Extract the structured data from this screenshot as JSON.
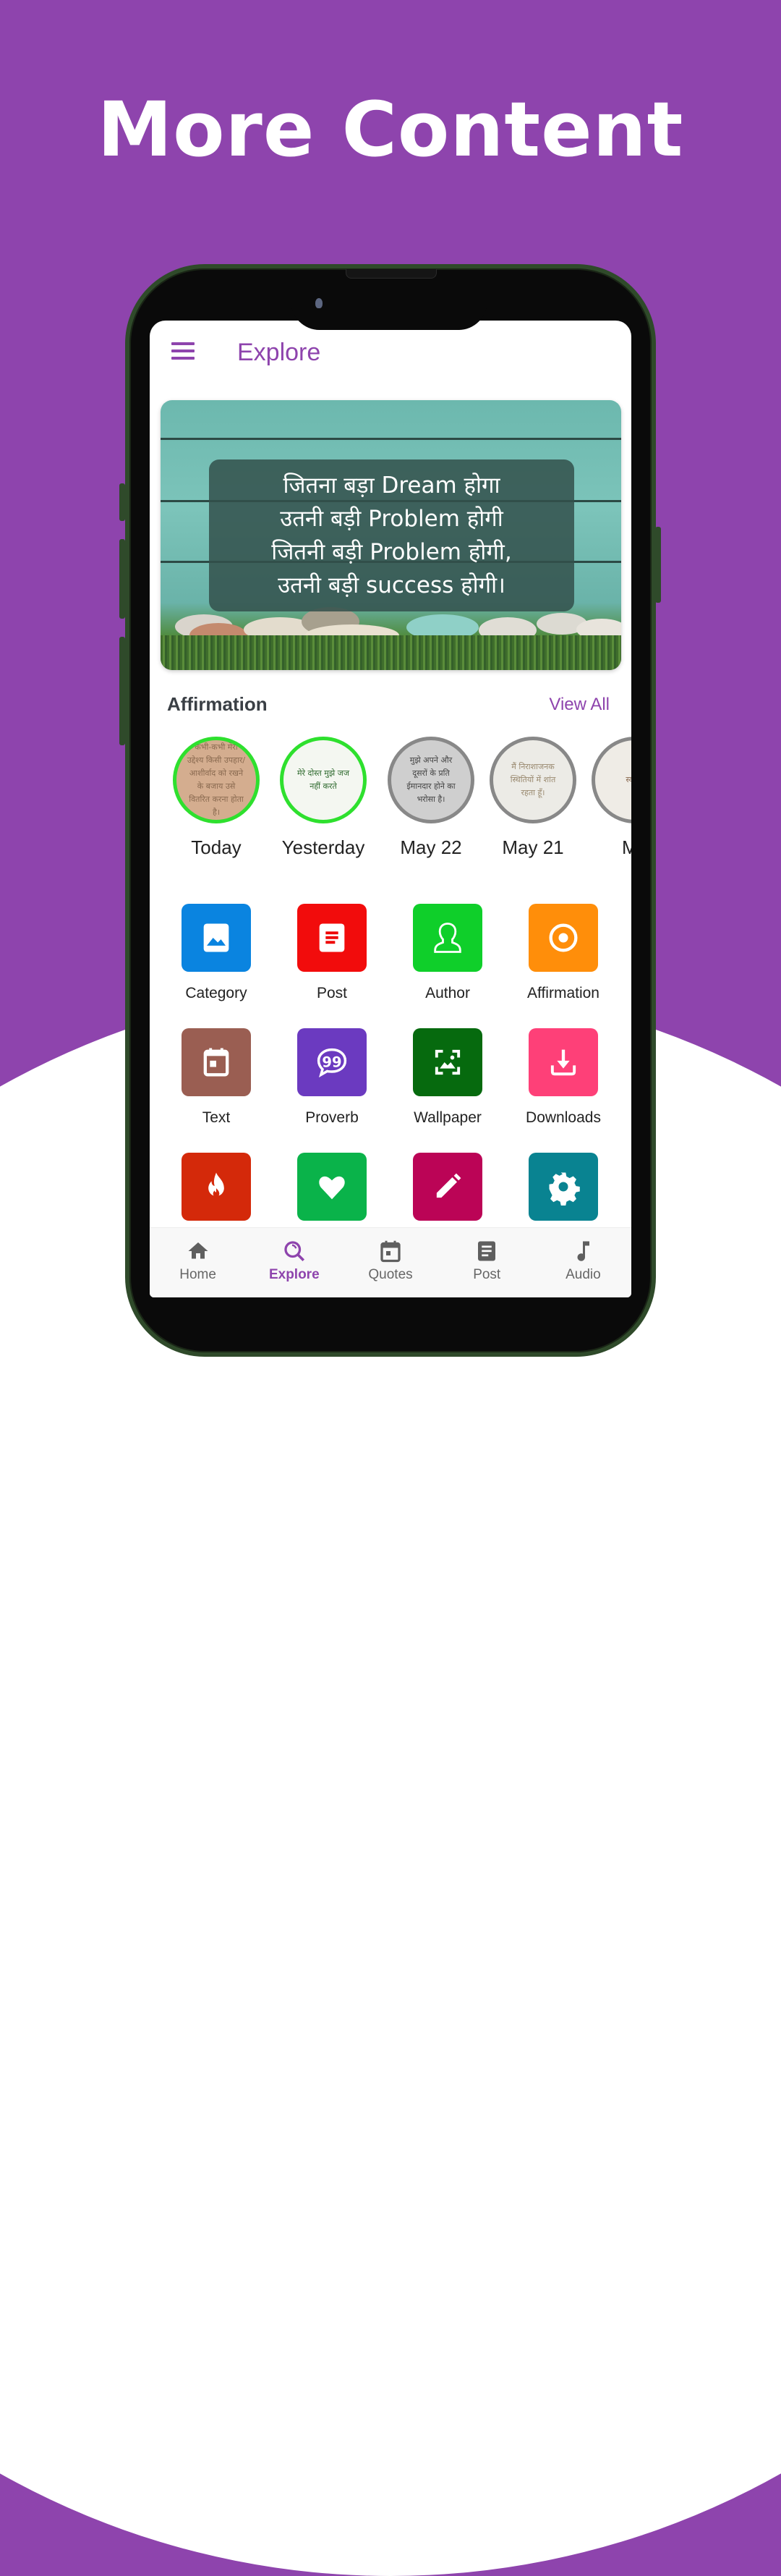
{
  "headline": "More Content",
  "colors": {
    "brand": "#8e44ad",
    "active_story_ring": "#2ee02e",
    "inactive_story_ring": "#888888"
  },
  "appbar": {
    "title": "Explore",
    "menu_icon": "hamburger-menu-icon"
  },
  "banner": {
    "quote_lines": [
      "जितना बड़ा Dream होगा",
      "उतनी बड़ी Problem होगी",
      "जितनी बड़ी Problem होगी,",
      "उतनी बड़ी success होगी।"
    ]
  },
  "affirmation": {
    "title": "Affirmation",
    "view_all": "View All",
    "stories": [
      {
        "label": "Today",
        "text": "कभी-कभी मेरा उद्देश्य किसी उपहार/आशीर्वाद को रखने के बजाय उसे वितरित करना होता है।",
        "seen": false
      },
      {
        "label": "Yesterday",
        "text": "मेरे दोस्त मुझे जज नहीं करते",
        "seen": false
      },
      {
        "label": "May 22",
        "text": "मुझे अपने और दूसरों के प्रति ईमानदार होने का भरोसा है।",
        "seen": true
      },
      {
        "label": "May 21",
        "text": "मैं निराशाजनक स्थितियों में शांत रहता हूँ।",
        "seen": true
      },
      {
        "label": "Ma",
        "text": "स्वी अ",
        "seen": true
      }
    ]
  },
  "grid": [
    {
      "label": "Category",
      "icon": "image-icon",
      "color": "#0a84e0"
    },
    {
      "label": "Post",
      "icon": "article-icon",
      "color": "#f20c0c"
    },
    {
      "label": "Author",
      "icon": "person-icon",
      "color": "#0fcf2a"
    },
    {
      "label": "Affirmation",
      "icon": "radio-target-icon",
      "color": "#ff8e0a"
    },
    {
      "label": "Text",
      "icon": "calendar-icon",
      "color": "#9a5e52"
    },
    {
      "label": "Proverb",
      "icon": "quote-bubble-icon",
      "color": "#6b3ac0"
    },
    {
      "label": "Wallpaper",
      "icon": "wallpaper-icon",
      "color": "#066a0e"
    },
    {
      "label": "Downloads",
      "icon": "download-icon",
      "color": "#fe4078"
    },
    {
      "label": "",
      "icon": "fire-icon",
      "color": "#d4290a"
    },
    {
      "label": "",
      "icon": "heart-icon",
      "color": "#0ab34a"
    },
    {
      "label": "",
      "icon": "pencil-icon",
      "color": "#bb0456"
    },
    {
      "label": "",
      "icon": "gear-icon",
      "color": "#098391"
    }
  ],
  "bottom_nav": [
    {
      "label": "Home",
      "icon": "home-icon",
      "active": false
    },
    {
      "label": "Explore",
      "icon": "explore-search-icon",
      "active": true
    },
    {
      "label": "Quotes",
      "icon": "calendar-icon",
      "active": false
    },
    {
      "label": "Post",
      "icon": "article-icon",
      "active": false
    },
    {
      "label": "Audio",
      "icon": "music-note-icon",
      "active": false
    }
  ]
}
